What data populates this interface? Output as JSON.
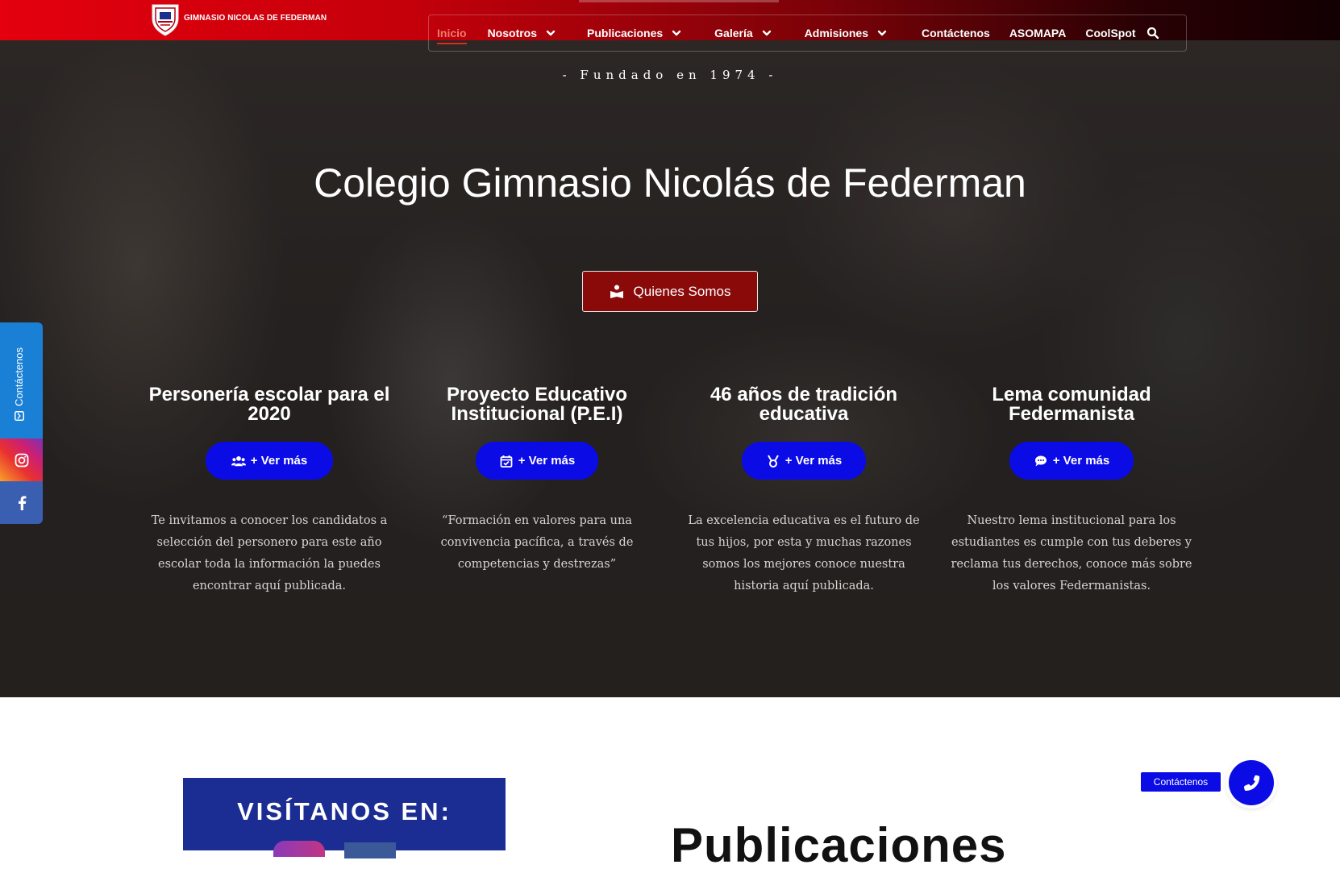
{
  "header": {
    "logo_text": "GIMNASIO NICOLAS DE FEDERMAN",
    "nav": [
      {
        "label": "Inicio",
        "active": true,
        "dropdown": false
      },
      {
        "label": "Nosotros",
        "dropdown": true
      },
      {
        "label": "Publicaciones",
        "dropdown": true
      },
      {
        "label": "Galería",
        "dropdown": true
      },
      {
        "label": "Admisiones",
        "dropdown": true
      },
      {
        "label": "Contáctenos",
        "dropdown": false
      },
      {
        "label": "ASOMAPA",
        "dropdown": false
      },
      {
        "label": "CoolSpot",
        "dropdown": false
      }
    ],
    "search_icon": "search-icon"
  },
  "hero": {
    "founded": "- Fundado en 1974 -",
    "title": "Colegio Gimnasio Nicolás de Federman",
    "cta_label": "Quienes Somos",
    "cta_icon": "reader-icon"
  },
  "features": [
    {
      "title": "Personería escolar para el 2020",
      "button": "+ Ver más",
      "icon": "users-icon",
      "text": "Te invitamos a conocer los candidatos a selección del personero para este año escolar toda la información la puedes encontrar aquí publicada."
    },
    {
      "title": "Proyecto Educativo Institucional (P.E.I)",
      "button": "+ Ver más",
      "icon": "calendar-check-icon",
      "text": "“Formación en valores para una convivencia pacífica, a través de competencias y destrezas”"
    },
    {
      "title": "46 años de tradición educativa",
      "button": "+ Ver más",
      "icon": "medal-icon",
      "text": "La excelencia educativa es el futuro de tus hijos, por esta y muchas razones somos los mejores conoce nuestra historia aquí publicada."
    },
    {
      "title": "Lema comunidad Federmanista",
      "button": "+ Ver más",
      "icon": "comment-dots-icon",
      "text": "Nuestro lema institucional para los estudiantes es cumple con tus deberes y reclama tus derechos, conoce más sobre los valores Federmanistas."
    }
  ],
  "side_tab": {
    "contact_label": "Contáctenos"
  },
  "lower": {
    "visit_title": "VISÍTANOS EN:",
    "publications_title": "Publicaciones"
  },
  "floating": {
    "label": "Contáctenos"
  },
  "colors": {
    "brand_red": "#e4000e",
    "button_blue": "#0b0be6",
    "cta_red": "#8a0a0a"
  }
}
